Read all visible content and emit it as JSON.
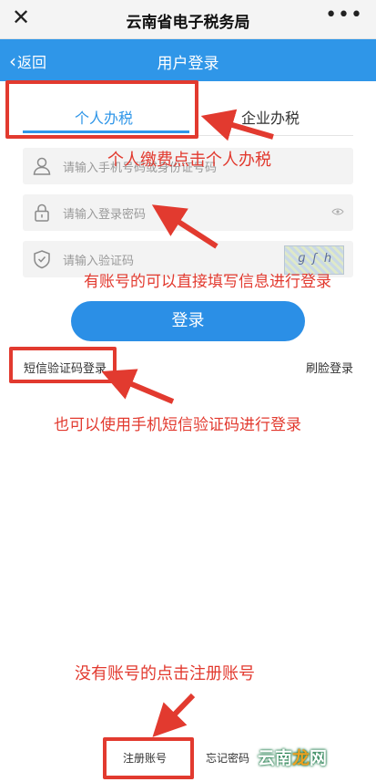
{
  "window": {
    "title": "云南省电子税务局"
  },
  "nav": {
    "back_label": "返回",
    "title": "用户登录"
  },
  "tabs": [
    {
      "label": "个人办税",
      "active": true
    },
    {
      "label": "企业办税",
      "active": false
    }
  ],
  "form": {
    "username_placeholder": "请输入手机号码或身份证号码",
    "password_placeholder": "请输入登录密码",
    "captcha_placeholder": "请输入验证码",
    "login_label": "登录"
  },
  "links": {
    "sms_login": "短信验证码登录",
    "face_login": "刷脸登录",
    "register": "注册账号",
    "forgot": "忘记密码"
  },
  "annotations": {
    "personal": "个人缴费点击个人办税",
    "account": "有账号的可以直接填写信息进行登录",
    "sms": "也可以使用手机短信验证码进行登录",
    "register": "没有账号的点击注册账号"
  },
  "watermark": {
    "text1": "云南",
    "text2": "龙",
    "text3": "网"
  },
  "colors": {
    "primary": "#2f96e8",
    "annotation": "#e23a2f"
  }
}
